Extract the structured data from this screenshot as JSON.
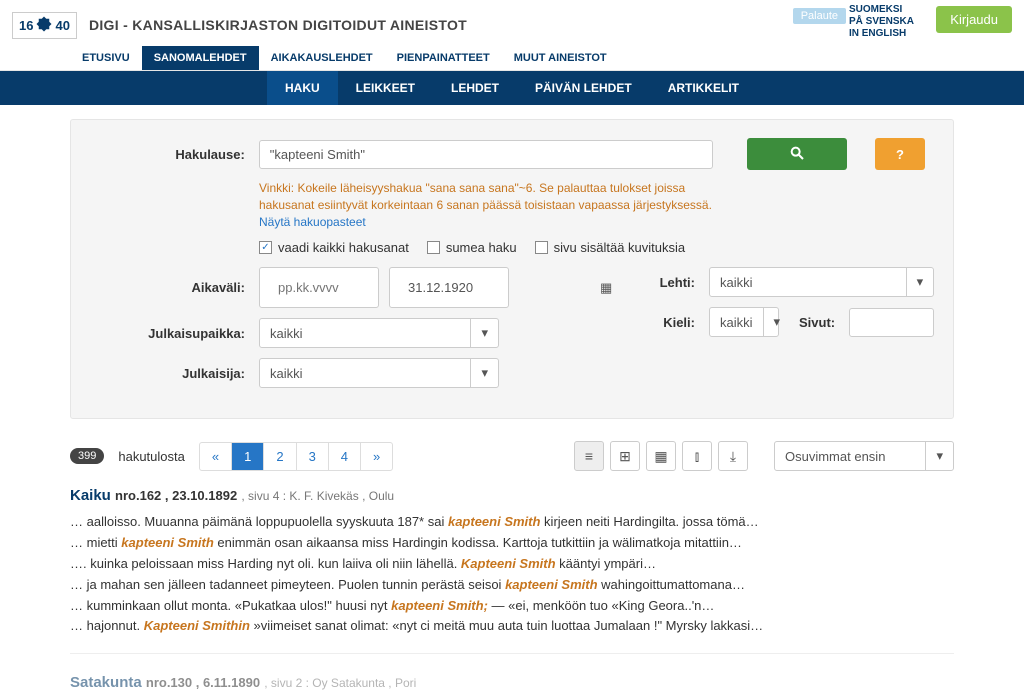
{
  "header": {
    "logo_text": "1640",
    "site_title": "DIGI - KANSALLISKIRJASTON DIGITOIDUT AINEISTOT",
    "feedback": "Palaute",
    "langs": [
      "SUOMEKSI",
      "PÅ SVENSKA",
      "IN ENGLISH"
    ],
    "login": "Kirjaudu",
    "tabs1": [
      {
        "label": "ETUSIVU",
        "active": false
      },
      {
        "label": "SANOMALEHDET",
        "active": true
      },
      {
        "label": "AIKAKAUSLEHDET",
        "active": false
      },
      {
        "label": "PIENPAINATTEET",
        "active": false
      },
      {
        "label": "MUUT AINEISTOT",
        "active": false
      }
    ],
    "navy": [
      {
        "label": "HAKU",
        "active": true
      },
      {
        "label": "LEIKKEET",
        "active": false
      },
      {
        "label": "LEHDET",
        "active": false
      },
      {
        "label": "PÄIVÄN LEHDET",
        "active": false
      },
      {
        "label": "ARTIKKELIT",
        "active": false
      }
    ]
  },
  "search": {
    "labels": {
      "query": "Hakulause:",
      "time": "Aikaväli:",
      "place": "Julkaisupaikka:",
      "publisher": "Julkaisija:",
      "journal": "Lehti:",
      "lang": "Kieli:",
      "pages": "Sivut:"
    },
    "query_value": "\"kapteeni Smith\"",
    "hint_pre": "Vinkki: Kokeile läheisyyshakua \"sana sana sana\"~6. Se palauttaa tulokset joissa hakusanat esiintyvät korkeintaan 6 sanan päässä toisistaan vapaassa järjestyksessä.",
    "hint_link": "Näytä hakuopasteet",
    "checks": {
      "require_all": "vaadi kaikki hakusanat",
      "fuzzy": "sumea haku",
      "illustrated": "sivu sisältää kuvituksia"
    },
    "date_from_placeholder": "pp.kk.vvvv",
    "date_to": "31.12.1920",
    "place_value": "kaikki",
    "publisher_value": "kaikki",
    "journal_value": "kaikki",
    "lang_value": "kaikki",
    "pages_value": ""
  },
  "results": {
    "count": "399",
    "count_label": "hakutulosta",
    "pages": [
      "«",
      "1",
      "2",
      "3",
      "4",
      "»"
    ],
    "active_page": "1",
    "sort": "Osuvimmat ensin",
    "items": [
      {
        "title": "Kaiku",
        "issue": "nro.162 , 23.10.1892",
        "meta": ", sivu 4 : K. F. Kivekäs , Oulu",
        "snippets": [
          {
            "pre": "… aalloisso. Muuanna päimänä loppupuolella syyskuuta 187* sai ",
            "hl": "kapteeni Smith",
            "post": " kirjeen neiti Hardingilta. jossa tömä…"
          },
          {
            "pre": "… mietti ",
            "hl": "kapteeni Smith",
            "post": " enimmän osan aikaansa miss Hardingin kodissa. Karttoja tutkittiin ja wälimatkoja mitattiin…"
          },
          {
            "pre": "…. kuinka peloissaan miss Harding nyt oli. kun laiiva oli niin lähellä. ",
            "hl": "Kapteeni Smith",
            "post": " kääntyi ympäri…"
          },
          {
            "pre": "… ja mahan sen jälleen tadanneet pimeyteen. Puolen tunnin perästä seisoi ",
            "hl": "kapteeni Smith",
            "post": " wahingoittumattomana…"
          },
          {
            "pre": "… kumminkaan ollut monta. «Pukatkaa ulos!\" huusi nyt ",
            "hl": "kapteeni Smith;",
            "post": " — «ei, menköön tuo «King Geora..'n…"
          },
          {
            "pre": "… hajonnut. ",
            "hl": "Kapteeni Smithin",
            "post": " »viimeiset sanat olimat: «nyt ci meitä muu auta tuin luottaa Jumalaan !\" Myrsky lakkasi…"
          }
        ]
      },
      {
        "title": "Satakunta",
        "issue": "nro.130 , 6.11.1890",
        "meta": ", sivu 2 : Oy Satakunta , Pori",
        "snippets": []
      }
    ]
  }
}
